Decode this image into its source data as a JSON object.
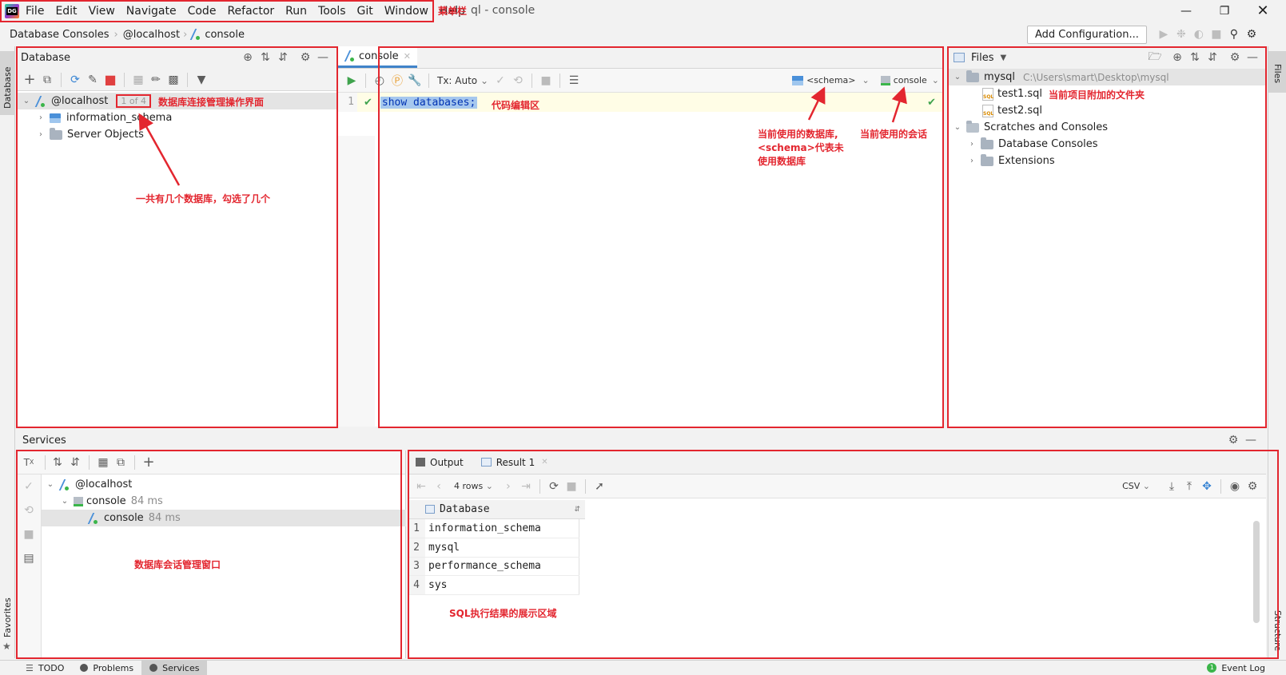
{
  "menubar": {
    "items": [
      "File",
      "Edit",
      "View",
      "Navigate",
      "Code",
      "Refactor",
      "Run",
      "Tools",
      "Git",
      "Window",
      "Help"
    ],
    "title": "ql - console",
    "annotation": "菜单栏"
  },
  "breadcrumb": {
    "items": [
      "Database Consoles",
      "@localhost",
      "console"
    ],
    "add_config": "Add Configuration..."
  },
  "database_panel": {
    "title": "Database",
    "side_tab": "Database",
    "tree": {
      "root": "@localhost",
      "root_badge": "1 of 4",
      "children": [
        "information_schema",
        "Server Objects"
      ]
    },
    "annotation": "数据库连接管理操作界面",
    "annotation2": "一共有几个数据库，勾选了几个"
  },
  "editor": {
    "tab": "console",
    "tx_label": "Tx: Auto",
    "schema_label": "<schema>",
    "session_label": "console",
    "line_number": "1",
    "code": "show databases;",
    "annotation": "代码编辑区",
    "annotation_schema": [
      "当前使用的数据库,",
      "<schema>代表未",
      "使用数据库"
    ],
    "annotation_session": "当前使用的会话"
  },
  "files_panel": {
    "title": "Files",
    "side_tab": "Files",
    "tree": {
      "root": "mysql",
      "root_path": "C:\\Users\\smart\\Desktop\\mysql",
      "files": [
        "test1.sql",
        "test2.sql"
      ],
      "scratches": "Scratches and Consoles",
      "scratch_children": [
        "Database Consoles",
        "Extensions"
      ]
    },
    "annotation": "当前项目附加的文件夹"
  },
  "services": {
    "title": "Services",
    "tree": {
      "root": "@localhost",
      "child": "console",
      "child_time": "84 ms",
      "grandchild": "console",
      "grandchild_time": "84 ms"
    },
    "annotation": "数据库会话管理窗口",
    "tabs": [
      "Output",
      "Result 1"
    ],
    "rows_label": "4 rows",
    "csv_label": "CSV",
    "column": "Database",
    "rows": [
      {
        "n": "1",
        "v": "information_schema"
      },
      {
        "n": "2",
        "v": "mysql"
      },
      {
        "n": "3",
        "v": "performance_schema"
      },
      {
        "n": "4",
        "v": "sys"
      }
    ],
    "result_annotation": "SQL执行结果的展示区域"
  },
  "left_strip": {
    "favorites": "Favorites"
  },
  "right_strip": {
    "structure": "Structure"
  },
  "statusbar": {
    "items": [
      "TODO",
      "Problems",
      "Services"
    ],
    "event_log": "Event Log"
  },
  "colors": {
    "accent": "#4083c9",
    "annotation": "#e3262f",
    "selection": "#a6c8ee"
  }
}
